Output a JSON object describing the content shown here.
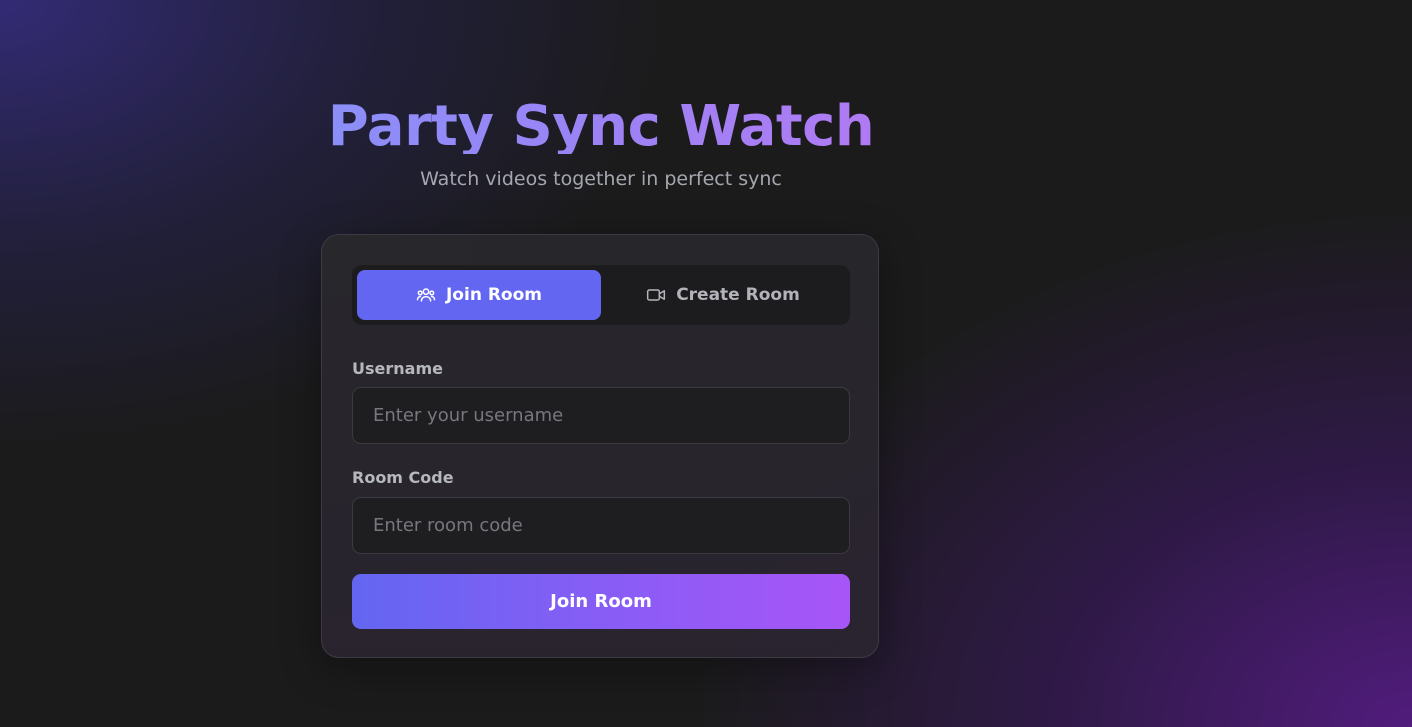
{
  "app": {
    "title": "Party Sync Watch",
    "subtitle": "Watch videos together in perfect sync"
  },
  "tabs": [
    {
      "label": "Join Room",
      "icon": "users-icon",
      "active": true
    },
    {
      "label": "Create Room",
      "icon": "video-camera-icon",
      "active": false
    }
  ],
  "form": {
    "username": {
      "label": "Username",
      "value": "",
      "placeholder": "Enter your username"
    },
    "room_code": {
      "label": "Room Code",
      "value": "",
      "placeholder": "Enter room code"
    },
    "submit_label": "Join Room"
  },
  "colors": {
    "accent": "#6366f1",
    "gradient_end": "#a855f7",
    "background": "#1b1b1b"
  }
}
